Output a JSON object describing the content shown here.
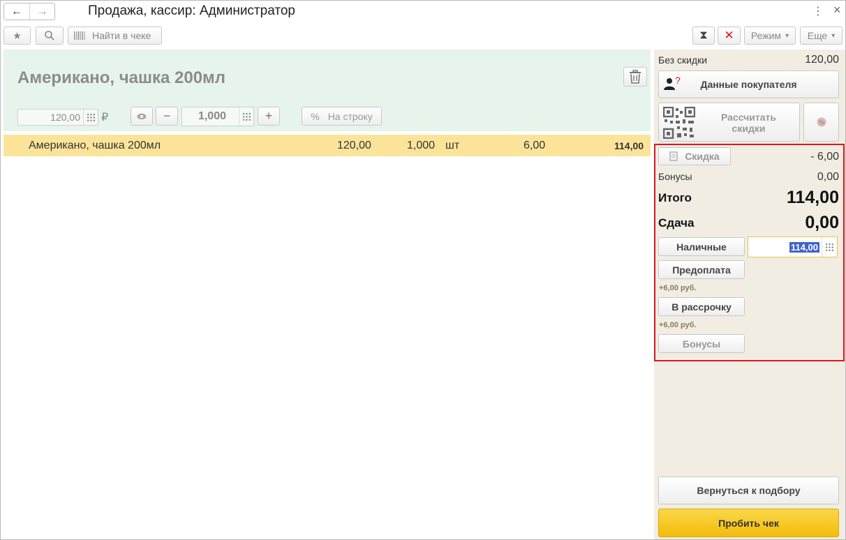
{
  "window": {
    "title": "Продажа, кассир: Администратор",
    "back_icon": "←",
    "forward_icon": "→",
    "menu_icon": "⋮",
    "close_icon": "×"
  },
  "toolbar": {
    "star_icon": "★",
    "search_icon": "⚲",
    "find_label": "Найти в чеке",
    "timer_icon": "⧗",
    "cancel_icon": "✕",
    "mode_label": "Режим",
    "more_label": "Еще",
    "dropdown_icon": "▾"
  },
  "product": {
    "title": "Американо, чашка 200мл",
    "price": "120,00",
    "currency": "₽",
    "quantity": "1,000",
    "per_line_label": "На строку",
    "percent_icon": "%",
    "minus_icon": "−",
    "plus_icon": "+"
  },
  "lines": [
    {
      "name": "Американо, чашка 200мл",
      "price": "120,00",
      "quantity": "1,000",
      "unit": "шт",
      "discount": "6,00",
      "total": "114,00"
    }
  ],
  "summary": {
    "no_discount_label": "Без скидки",
    "no_discount_value": "120,00",
    "customer_label": "Данные покупателя",
    "customer_question": "?",
    "calc_discount_label_1": "Рассчитать",
    "calc_discount_label_2": "скидки",
    "discount_label": "Скидка",
    "discount_value": "- 6,00",
    "bonus_label": "Бонусы",
    "bonus_value": "0,00",
    "total_label": "Итого",
    "total_value": "114,00",
    "change_label": "Сдача",
    "change_value": "0,00"
  },
  "payments": {
    "cash_label": "Наличные",
    "cash_value": "114,00",
    "prepay_label": "Предоплата",
    "prepay_note": "+6,00 руб.",
    "installment_label": "В рассрочку",
    "installment_note": "+6,00 руб.",
    "bonuses_label": "Бонусы"
  },
  "actions": {
    "back_to_selection": "Вернуться к подбору",
    "punch_receipt": "Пробить чек"
  },
  "colors": {
    "header_bg": "#e6f4ec",
    "selected_row": "#fbe499",
    "side_panel": "#f1ede3",
    "highlight_box": "#e0141e",
    "primary_button": "#f9c91a"
  }
}
